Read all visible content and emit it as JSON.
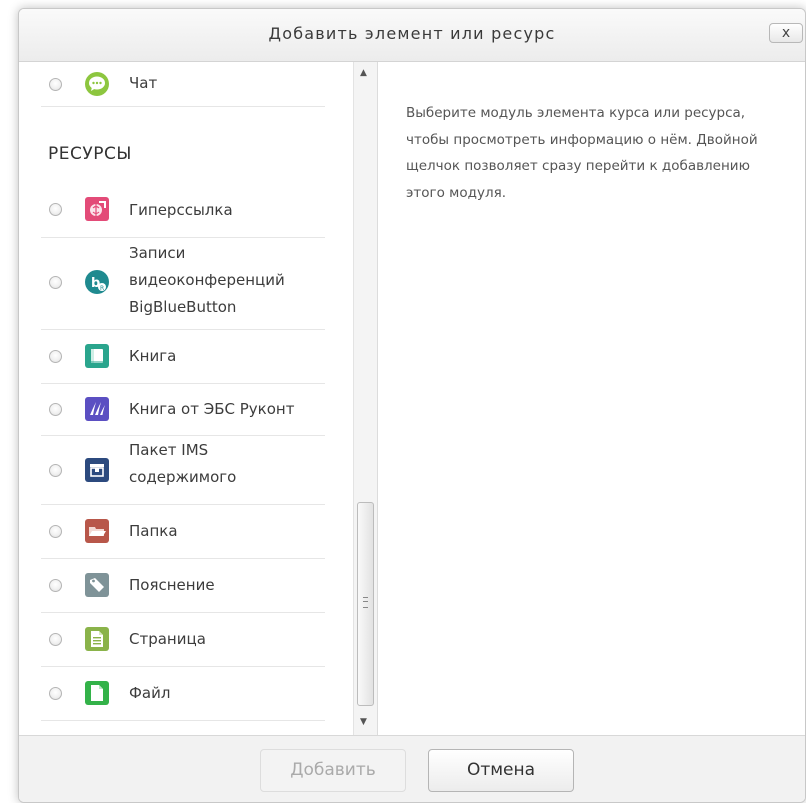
{
  "dialog": {
    "title": "Добавить элемент или ресурс",
    "close_label": "x"
  },
  "options": {
    "activities_tail": [
      {
        "label": "Чат",
        "icon": "chat-icon"
      }
    ],
    "resources_heading": "РЕСУРСЫ",
    "resources": [
      {
        "label": "Гиперссылка",
        "icon": "url-icon"
      },
      {
        "label_lines": [
          "Записи",
          "видеоконференций",
          "BigBlueButton"
        ],
        "icon": "bigbluebutton-icon"
      },
      {
        "label": "Книга",
        "icon": "book-icon"
      },
      {
        "label": "Книга от ЭБС Руконт",
        "icon": "rucont-book-icon"
      },
      {
        "label_lines": [
          "Пакет IMS",
          "содержимого"
        ],
        "icon": "ims-package-icon"
      },
      {
        "label": "Папка",
        "icon": "folder-icon"
      },
      {
        "label": "Пояснение",
        "icon": "label-tag-icon"
      },
      {
        "label": "Страница",
        "icon": "page-icon"
      },
      {
        "label": "Файл",
        "icon": "file-icon"
      }
    ]
  },
  "detail": {
    "text": "Выберите модуль элемента курса или ресурса, чтобы просмотреть информацию о нём. Двойной щелчок позволяет сразу перейти к добавлению этого модуля."
  },
  "footer": {
    "add_label": "Добавить",
    "cancel_label": "Отмена"
  },
  "colors": {
    "chat": "#8dc63f",
    "url": "#e34b78",
    "bigbluebutton": "#1f8a8f",
    "book": "#2aa58d",
    "rucont": "#5b4fc2",
    "ims": "#2c4a7e",
    "folder": "#b8574a",
    "label": "#7f9398",
    "page": "#8ab34a",
    "file": "#33b249"
  }
}
